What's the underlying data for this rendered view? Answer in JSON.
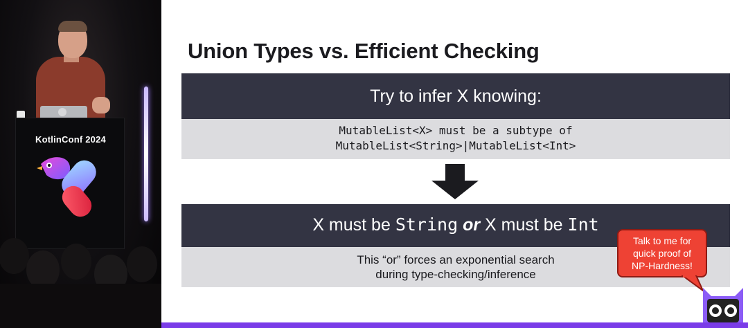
{
  "stage": {
    "podium_label": "KotlinConf 2024"
  },
  "slide": {
    "title": "Union Types vs. Efficient Checking",
    "box1": {
      "heading": "Try to infer X knowing:",
      "line1": "MutableList<X> must be a subtype of",
      "line2": "MutableList<String>|MutableList<Int>"
    },
    "box2": {
      "heading_part1": "X must be ",
      "heading_type1": "String",
      "heading_or": "or",
      "heading_part2": " X must be ",
      "heading_type2": "Int",
      "line1": "This “or” forces an exponential search",
      "line2": "during type-checking/inference"
    },
    "callout": {
      "line1": "Talk to me for",
      "line2": "quick proof of",
      "line3": "NP-Hardness!"
    }
  },
  "colors": {
    "box_header": "#333443",
    "box_body": "#dcdcdf",
    "accent_bar": "#7a3ce8",
    "callout": "#ee4234",
    "mascot": "#8b5cf6"
  }
}
